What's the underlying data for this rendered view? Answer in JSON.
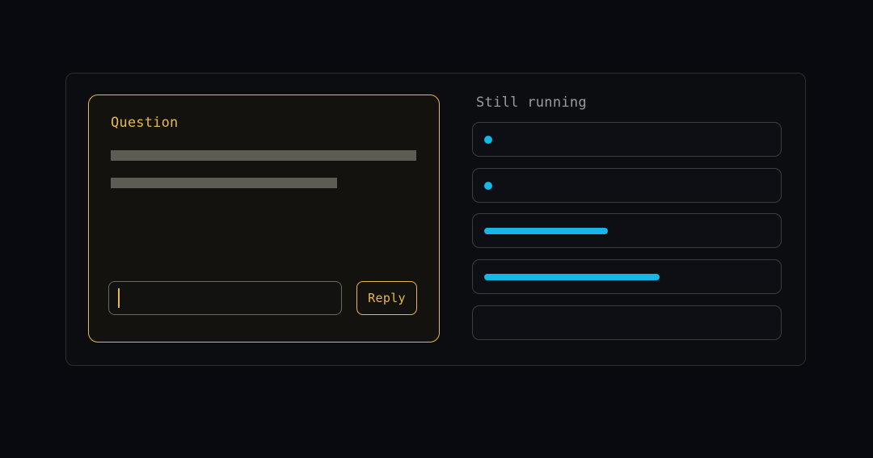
{
  "question": {
    "title": "Question",
    "input_value": "",
    "reply_label": "Reply"
  },
  "running": {
    "title": "Still running",
    "tasks": [
      {
        "indicator": "dot"
      },
      {
        "indicator": "dot"
      },
      {
        "indicator": "progress",
        "progress": 0.43
      },
      {
        "indicator": "progress",
        "progress": 0.61
      },
      {
        "indicator": "none"
      }
    ]
  },
  "colors": {
    "accent": "#e7b94a",
    "progress": "#16b6e7",
    "background": "#090a0f"
  }
}
